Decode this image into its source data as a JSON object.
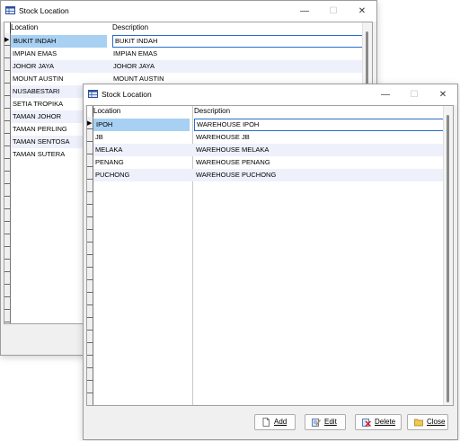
{
  "back_window": {
    "title": "Stock Location",
    "controls": {
      "minimize": "—",
      "maximize": "☐",
      "close": "✕"
    },
    "columns": {
      "location": "Location",
      "description": "Description"
    },
    "rows": [
      {
        "location": "BUKIT INDAH",
        "description": "BUKIT INDAH"
      },
      {
        "location": "IMPIAN EMAS",
        "description": "IMPIAN EMAS"
      },
      {
        "location": "JOHOR JAYA",
        "description": "JOHOR JAYA"
      },
      {
        "location": "MOUNT AUSTIN",
        "description": "MOUNT AUSTIN"
      },
      {
        "location": "NUSABESTARI",
        "description": ""
      },
      {
        "location": "SETIA TROPIKA",
        "description": ""
      },
      {
        "location": "TAMAN JOHOR",
        "description": ""
      },
      {
        "location": "TAMAN PERLING",
        "description": ""
      },
      {
        "location": "TAMAN SENTOSA",
        "description": ""
      },
      {
        "location": "TAMAN SUTERA",
        "description": ""
      }
    ]
  },
  "front_window": {
    "title": "Stock Location",
    "controls": {
      "minimize": "—",
      "maximize": "☐",
      "close": "✕"
    },
    "columns": {
      "location": "Location",
      "description": "Description"
    },
    "rows": [
      {
        "location": "IPOH",
        "description": "WAREHOUSE IPOH"
      },
      {
        "location": "JB",
        "description": "WAREHOUSE JB"
      },
      {
        "location": "MELAKA",
        "description": "WAREHOUSE MELAKA"
      },
      {
        "location": "PENANG",
        "description": "WAREHOUSE PENANG"
      },
      {
        "location": "PUCHONG",
        "description": "WAREHOUSE PUCHONG"
      }
    ],
    "buttons": {
      "add": "Add",
      "edit": "Edit",
      "delete": "Delete",
      "close": "Close"
    }
  },
  "colors": {
    "selection": "#a7d0f2",
    "alt_row": "#eef0fb",
    "focus_border": "#2a6cc8"
  }
}
